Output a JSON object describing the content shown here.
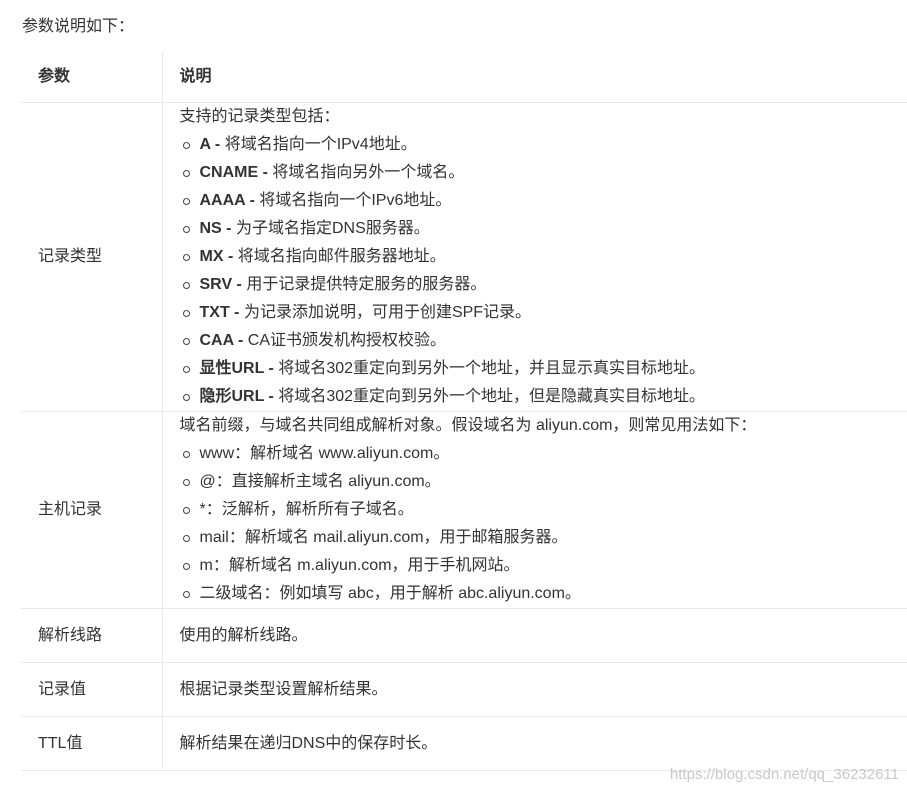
{
  "intro": "参数说明如下：",
  "table": {
    "headers": [
      "参数",
      "说明"
    ],
    "record_type": {
      "param": "记录类型",
      "lead": "支持的记录类型包括：",
      "items": [
        {
          "key": "A",
          "sep": " - ",
          "text": "将域名指向一个IPv4地址。"
        },
        {
          "key": "CNAME",
          "sep": " - ",
          "text": "将域名指向另外一个域名。"
        },
        {
          "key": "AAAA",
          "sep": " - ",
          "text": "将域名指向一个IPv6地址。"
        },
        {
          "key": "NS",
          "sep": " - ",
          "text": "为子域名指定DNS服务器。"
        },
        {
          "key": "MX",
          "sep": " - ",
          "text": "将域名指向邮件服务器地址。"
        },
        {
          "key": "SRV",
          "sep": " - ",
          "text": "用于记录提供特定服务的服务器。"
        },
        {
          "key": "TXT",
          "sep": " - ",
          "text": "为记录添加说明，可用于创建SPF记录。"
        },
        {
          "key": "CAA",
          "sep": " - ",
          "text": "CA证书颁发机构授权校验。"
        },
        {
          "key": "显性URL",
          "sep": " - ",
          "text": "将域名302重定向到另外一个地址，并且显示真实目标地址。"
        },
        {
          "key": "隐形URL",
          "sep": " - ",
          "text": "将域名302重定向到另外一个地址，但是隐藏真实目标地址。"
        }
      ]
    },
    "host_record": {
      "param": "主机记录",
      "lead": "域名前缀，与域名共同组成解析对象。假设域名为 aliyun.com，则常见用法如下：",
      "items": [
        "www：解析域名 www.aliyun.com。",
        "@：直接解析主域名 aliyun.com。",
        "*：泛解析，解析所有子域名。",
        "mail：解析域名 mail.aliyun.com，用于邮箱服务器。",
        "m：解析域名 m.aliyun.com，用于手机网站。",
        "二级域名：例如填写 abc，用于解析 abc.aliyun.com。"
      ]
    },
    "line": {
      "param": "解析线路",
      "desc": "使用的解析线路。"
    },
    "value": {
      "param": "记录值",
      "desc": "根据记录类型设置解析结果。"
    },
    "ttl": {
      "param": "TTL值",
      "desc": "解析结果在递归DNS中的保存时长。"
    }
  },
  "watermark": "https://blog.csdn.net/qq_36232611"
}
